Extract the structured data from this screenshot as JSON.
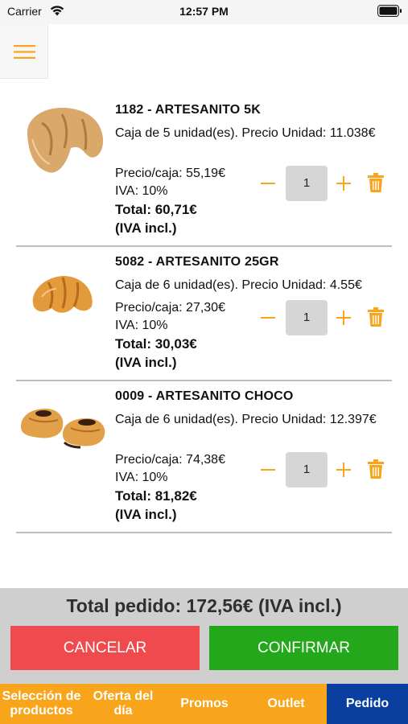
{
  "status_bar": {
    "carrier": "Carrier",
    "time": "12:57 PM"
  },
  "items": [
    {
      "title": "1182 - ARTESANITO 5K",
      "description": "Caja de 5 unidad(es). Precio Unidad: 11.038€",
      "price_box": "Precio/caja: 55,19€",
      "iva": "IVA: 10%",
      "total": "Total: 60,71€",
      "total_note": "(IVA incl.)",
      "quantity": "1",
      "image": "croissant-icon"
    },
    {
      "title": "5082 - ARTESANITO 25GR",
      "description": "Caja de 6 unidad(es). Precio Unidad: 4.55€",
      "price_box": "Precio/caja: 27,30€",
      "iva": "IVA: 10%",
      "total": "Total: 30,03€",
      "total_note": "(IVA incl.)",
      "quantity": "1",
      "image": "croissant-icon"
    },
    {
      "title": "0009 - ARTESANITO CHOCO",
      "description": "Caja de 6 unidad(es). Precio Unidad: 12.397€",
      "price_box": "Precio/caja: 74,38€",
      "iva": "IVA: 10%",
      "total": "Total: 81,82€",
      "total_note": "(IVA incl.)",
      "quantity": "1",
      "image": "chocolate-pastry-icon"
    }
  ],
  "footer": {
    "order_total": "Total pedido: 172,56€ (IVA incl.)",
    "cancel_label": "CANCELAR",
    "confirm_label": "CONFIRMAR"
  },
  "tabs": [
    {
      "label": "Selección de productos",
      "active": false
    },
    {
      "label": "Oferta del día",
      "active": false
    },
    {
      "label": "Promos",
      "active": false
    },
    {
      "label": "Outlet",
      "active": false
    },
    {
      "label": "Pedido",
      "active": true
    }
  ],
  "colors": {
    "accent_orange": "#f8a51c",
    "cancel_red": "#ef4a4d",
    "confirm_green": "#22a81a",
    "active_tab_blue": "#0a3fa0"
  }
}
